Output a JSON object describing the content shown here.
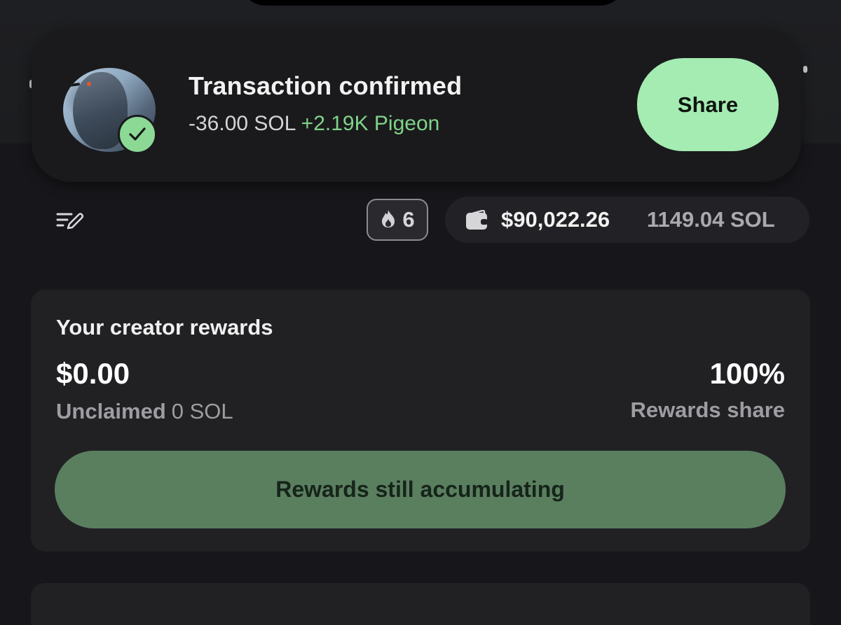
{
  "toast": {
    "title": "Transaction confirmed",
    "spent": "-36.00 SOL",
    "received": "+2.19K Pigeon",
    "share_label": "Share",
    "avatar_icon": "pigeon-avatar",
    "badge_icon": "checkmark-icon"
  },
  "toolbar": {
    "edit_icon": "edit-list-icon",
    "streak_icon": "flame-icon",
    "streak_count": "6",
    "wallet_icon": "wallet-icon",
    "balance_usd": "$90,022.26",
    "balance_sol": "1149.04 SOL"
  },
  "rewards": {
    "title": "Your creator rewards",
    "amount": "$0.00",
    "unclaimed_label": "Unclaimed",
    "unclaimed_value": "0 SOL",
    "share_percent": "100%",
    "share_label": "Rewards share",
    "button_label": "Rewards still accumulating"
  },
  "colors": {
    "background": "#17171b",
    "card": "#212124",
    "accent_green": "#a4ecb2",
    "gain_green": "#7fd38a",
    "muted_button": "#5a7f5f"
  }
}
